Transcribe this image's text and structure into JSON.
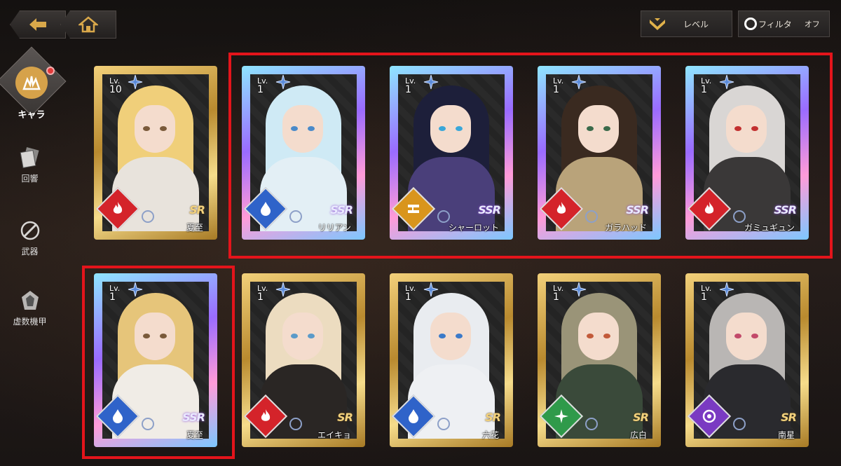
{
  "nav": {
    "back_icon": "back-arrow-icon",
    "home_icon": "home-icon"
  },
  "toolbar": {
    "sort_label": "レベル",
    "filter_label": "フィルタ",
    "filter_state": "オフ"
  },
  "sidebar": {
    "items": [
      {
        "label": "キャラ",
        "icon": "character-icon",
        "active": true
      },
      {
        "label": "回響",
        "icon": "echo-icon"
      },
      {
        "label": "武器",
        "icon": "weapon-icon"
      },
      {
        "label": "虚数機甲",
        "icon": "mecha-icon"
      }
    ]
  },
  "cards": [
    {
      "level_prefix": "Lv.",
      "level": "10",
      "rarity": "SR",
      "name": "夏至",
      "element": "fire",
      "element_color": "#d4232a",
      "hair": "#f0cf7a",
      "outfit": "#e8e3dc",
      "eyes": "#7a5a3a"
    },
    {
      "level_prefix": "Lv.",
      "level": "1",
      "rarity": "SSR",
      "name": "リリアン",
      "element": "water",
      "element_color": "#2f63c9",
      "hair": "#cfeaf5",
      "outfit": "#e3eff5",
      "eyes": "#4a8ac9"
    },
    {
      "level_prefix": "Lv.",
      "level": "1",
      "rarity": "SSR",
      "name": "シャーロット",
      "element": "earth",
      "element_color": "#d9951c",
      "hair": "#1d1f3a",
      "outfit": "#4a3f7a",
      "eyes": "#3aa7d9"
    },
    {
      "level_prefix": "Lv.",
      "level": "1",
      "rarity": "SSR",
      "name": "ガラハッド",
      "element": "fire",
      "element_color": "#d4232a",
      "hair": "#3a2a20",
      "outfit": "#b9a37a",
      "eyes": "#3a6a4a"
    },
    {
      "level_prefix": "Lv.",
      "level": "1",
      "rarity": "SSR",
      "name": "ガミュギュン",
      "element": "fire",
      "element_color": "#d4232a",
      "hair": "#d9d6d4",
      "outfit": "#3a3838",
      "eyes": "#c23030"
    },
    {
      "level_prefix": "Lv.",
      "level": "1",
      "rarity": "SSR",
      "name": "夏至",
      "element": "water",
      "element_color": "#2f63c9",
      "hair": "#e6c57a",
      "outfit": "#f0ece6",
      "eyes": "#7a5a3a"
    },
    {
      "level_prefix": "Lv.",
      "level": "1",
      "rarity": "SR",
      "name": "エイキョ",
      "element": "fire",
      "element_color": "#d4232a",
      "hair": "#ecdcc0",
      "outfit": "#2a2624",
      "eyes": "#5a9ac9"
    },
    {
      "level_prefix": "Lv.",
      "level": "1",
      "rarity": "SR",
      "name": "六花",
      "element": "water",
      "element_color": "#2f63c9",
      "hair": "#e9ecf0",
      "outfit": "#eef0f3",
      "eyes": "#3a7ac9"
    },
    {
      "level_prefix": "Lv.",
      "level": "1",
      "rarity": "SR",
      "name": "広白",
      "element": "wind",
      "element_color": "#2f9a4a",
      "hair": "#9a9478",
      "outfit": "#3a4a3a",
      "eyes": "#c25a3a"
    },
    {
      "level_prefix": "Lv.",
      "level": "1",
      "rarity": "SR",
      "name": "南星",
      "element": "void",
      "element_color": "#7a3ac2",
      "hair": "#b9b6b4",
      "outfit": "#2a2a2e",
      "eyes": "#c24a6a"
    }
  ]
}
